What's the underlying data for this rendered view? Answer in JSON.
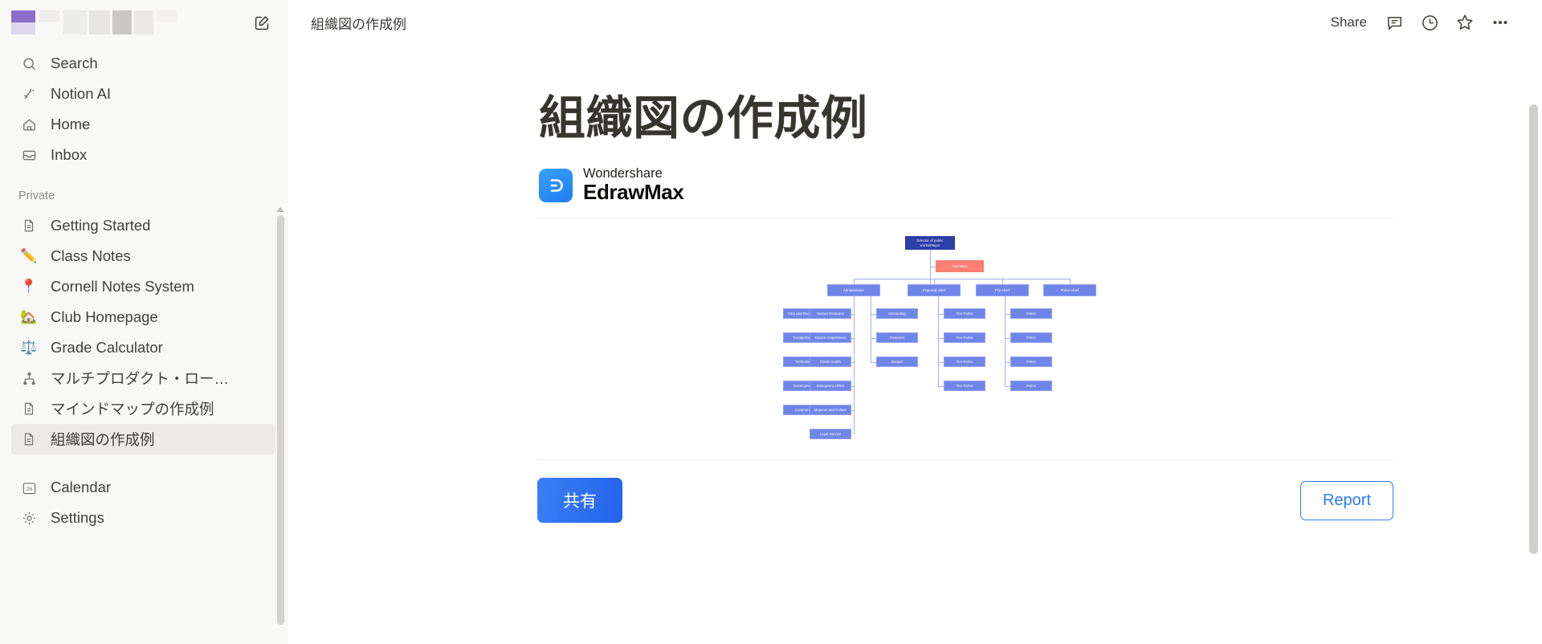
{
  "sidebar": {
    "workspace_name_blurred": true,
    "compose_icon": "compose-icon",
    "nav": [
      {
        "label": "Search",
        "icon": "search-icon"
      },
      {
        "label": "Notion AI",
        "icon": "notion-ai-icon"
      },
      {
        "label": "Home",
        "icon": "home-icon"
      },
      {
        "label": "Inbox",
        "icon": "inbox-icon"
      }
    ],
    "section_label": "Private",
    "pages": [
      {
        "label": "Getting Started",
        "icon": "page-icon",
        "emoji": "",
        "active": false
      },
      {
        "label": "Class Notes",
        "icon": "pencil-icon",
        "emoji": "✏️",
        "active": false
      },
      {
        "label": "Cornell Notes System",
        "icon": "pushpin-icon",
        "emoji": "📍",
        "active": false
      },
      {
        "label": "Club Homepage",
        "icon": "house-icon",
        "emoji": "🏡",
        "active": false
      },
      {
        "label": "Grade Calculator",
        "icon": "scales-icon",
        "emoji": "⚖️",
        "active": false
      },
      {
        "label": "マルチプロダクト・ロー…",
        "icon": "org-chart-icon",
        "emoji": "",
        "active": false
      },
      {
        "label": "マインドマップの作成例",
        "icon": "page-icon",
        "emoji": "",
        "active": false
      },
      {
        "label": "組織図の作成例",
        "icon": "page-icon",
        "emoji": "",
        "active": true
      }
    ],
    "footer": [
      {
        "label": "Calendar",
        "icon": "calendar-icon",
        "badge": "26"
      },
      {
        "label": "Settings",
        "icon": "gear-icon",
        "badge": ""
      }
    ]
  },
  "topbar": {
    "breadcrumb": "組織図の作成例",
    "share_label": "Share",
    "icons": [
      {
        "name": "comment-icon"
      },
      {
        "name": "history-clock-icon"
      },
      {
        "name": "star-icon"
      },
      {
        "name": "more-options-icon"
      }
    ]
  },
  "document": {
    "title": "組織図の作成例",
    "brand": {
      "line1": "Wondershare",
      "line2": "EdrawMax",
      "mark": "edrawmax-logo-icon"
    }
  },
  "actions": {
    "share_label": "共有",
    "report_label": "Report"
  },
  "colors": {
    "accent_blue": "#2563eb",
    "node_blue": "#6f86e8",
    "root_navy": "#2c3ea8",
    "secretary_salmon": "#fa8076",
    "link_line": "#9fb0f0",
    "sidebar_bg": "#f8f8f7",
    "active_item": "#eceae8"
  },
  "chart_data": {
    "type": "diagram",
    "subtype": "organization-chart",
    "title": "組織図の作成例",
    "root": "Director of public works/Mayor",
    "assistant": "Secretary",
    "levels": [
      {
        "level": 0,
        "nodes": [
          "Director of public works/Mayor"
        ]
      },
      {
        "level": 1,
        "nodes": [
          "Secretary"
        ]
      },
      {
        "level": 2,
        "nodes": [
          "Administrator",
          "Financial chief",
          "Fire chief",
          "Police chief"
        ]
      }
    ],
    "branches": [
      {
        "parent": "Administrator",
        "column": 1,
        "children": [
          "Park and Recreation",
          "Transportation",
          "Technology",
          "Development",
          "Community"
        ]
      },
      {
        "parent": "Administrator",
        "column": 2,
        "children": [
          "Human Resource",
          "Electric Department",
          "Public Health",
          "Emergency Office",
          "Museum and Culture",
          "Legal Service"
        ]
      },
      {
        "parent": "Financial chief",
        "column": 3,
        "children": [
          "Accounting",
          "Treasurer",
          "Budget"
        ]
      },
      {
        "parent": "Fire chief",
        "column": 4,
        "children": [
          "Fire Police",
          "Fire Police",
          "Fire Police",
          "Fire Police"
        ]
      },
      {
        "parent": "Police chief",
        "column": 5,
        "children": [
          "Police",
          "Police",
          "Police",
          "Police"
        ]
      }
    ]
  }
}
